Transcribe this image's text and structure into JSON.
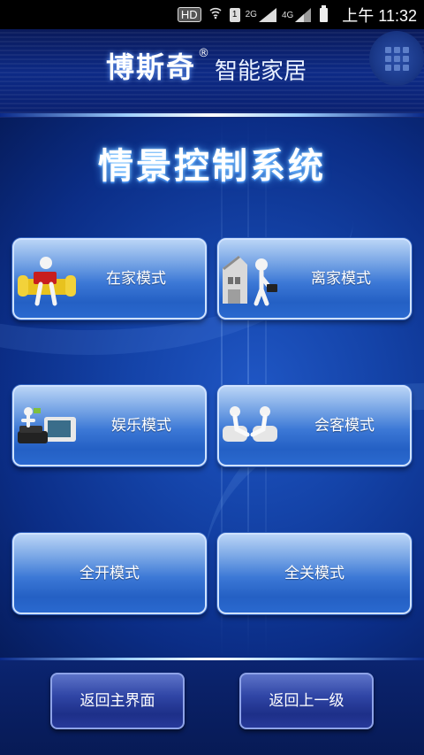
{
  "status_bar": {
    "hd": "HD",
    "sim": "1",
    "net_2g": "2G",
    "net_4g": "4G",
    "time": "上午 11:32"
  },
  "header": {
    "brand_name": "博斯奇",
    "brand_reg": "®",
    "brand_sub": "智能家居",
    "menu_icon": "grid-icon"
  },
  "title": "情景控制系统",
  "modes": [
    {
      "label": "在家模式",
      "icon": "person-on-sofa-icon"
    },
    {
      "label": "离家模式",
      "icon": "person-leaving-house-icon"
    },
    {
      "label": "娱乐模式",
      "icon": "tv-console-icon"
    },
    {
      "label": "会客模式",
      "icon": "guests-seated-icon"
    },
    {
      "label": "全开模式"
    },
    {
      "label": "全关模式"
    }
  ],
  "footer": {
    "home": "返回主界面",
    "back": "返回上一级"
  },
  "colors": {
    "accent": "#2460c4",
    "background": "#0a1f66",
    "title_glow": "#4aa0ff"
  }
}
